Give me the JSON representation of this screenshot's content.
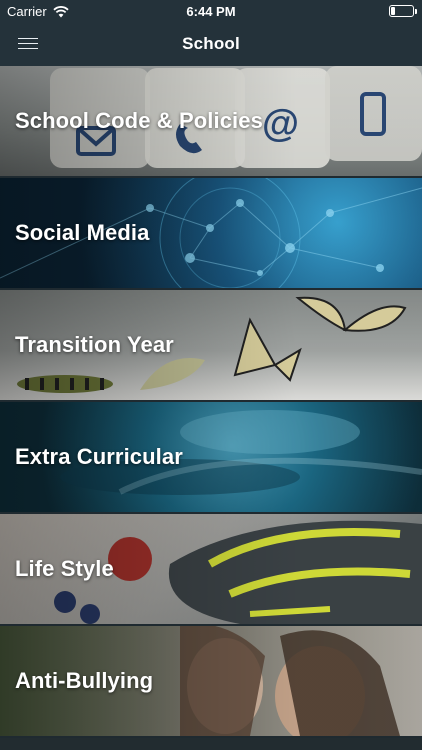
{
  "status_bar": {
    "carrier": "Carrier",
    "time": "6:44 PM",
    "battery_level": 0.2
  },
  "nav": {
    "title": "School",
    "menu_icon": "hamburger-menu-icon"
  },
  "items": [
    {
      "label": "School Code & Policies"
    },
    {
      "label": "Social Media"
    },
    {
      "label": "Transition Year"
    },
    {
      "label": "Extra Curricular"
    },
    {
      "label": "Life Style"
    },
    {
      "label": "Anti-Bullying"
    }
  ]
}
